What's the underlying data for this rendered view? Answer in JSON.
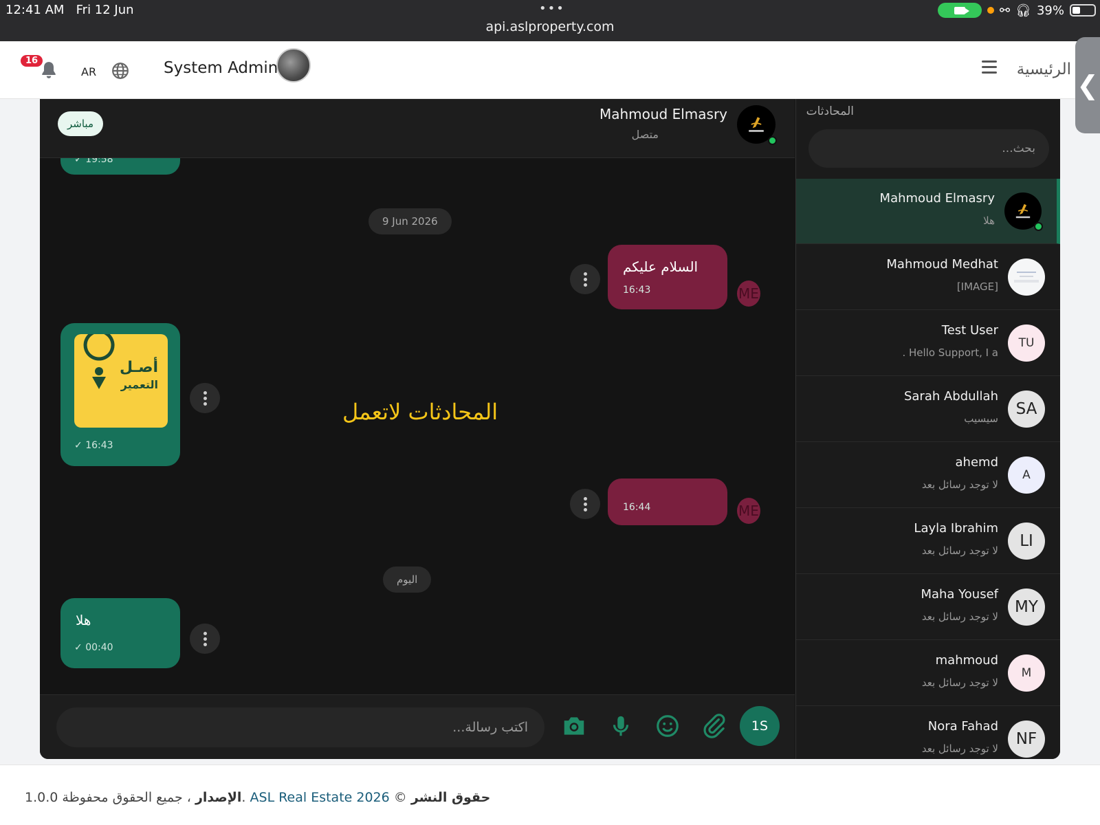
{
  "status_bar": {
    "time": "12:41 AM",
    "date": "Fri 12 Jun",
    "url": "api.aslproperty.com",
    "battery": "39%"
  },
  "header": {
    "notification_count": "16",
    "language": "AR",
    "user_name": "System Admin 1",
    "home_label": "الرئيسية"
  },
  "sidebar": {
    "title": "المحادثات",
    "search_placeholder": "بحث...",
    "conversations": [
      {
        "name": "Mahmoud Elmasry",
        "preview": "هلا",
        "avatar": "logo",
        "online": true,
        "active": true
      },
      {
        "name": "Mahmoud Medhat",
        "preview": "[IMAGE]",
        "avatar": "image"
      },
      {
        "name": "Test User",
        "preview": "Hello Support, I a .",
        "initials": "TU"
      },
      {
        "name": "Sarah Abdullah",
        "preview": "سيسيب",
        "initials": "SA"
      },
      {
        "name": "ahemd",
        "preview": "لا توجد رسائل بعد",
        "initials": "A"
      },
      {
        "name": "Layla Ibrahim",
        "preview": "لا توجد رسائل بعد",
        "initials": "LI"
      },
      {
        "name": "Maha Yousef",
        "preview": "لا توجد رسائل بعد",
        "initials": "MY"
      },
      {
        "name": "mahmoud",
        "preview": "لا توجد رسائل بعد",
        "initials": "M"
      },
      {
        "name": "Nora Fahad",
        "preview": "لا توجد رسائل بعد",
        "initials": "NF"
      }
    ]
  },
  "chat": {
    "live_label": "مباشر",
    "peer_name": "Mahmoud Elmasry",
    "peer_status": "متصل",
    "top_partial_time": "19:58",
    "date_pill_1": "9 Jun 2026",
    "msg_1_text": "السلام عليكم",
    "msg_1_time": "16:43",
    "msg_2_time": "16:43",
    "msg_2_logo_line1": "أصـل",
    "msg_2_logo_line2": "التعمير",
    "msg_3_time": "16:44",
    "date_pill_2": "اليوم",
    "msg_4_text": "هلا",
    "msg_4_time": "00:40",
    "me_initials": "ME",
    "overlay_text": "المحادثات لاتعمل",
    "composer_placeholder": "اكتب رسالة...",
    "sender_initials": "1S"
  },
  "footer": {
    "copyright_label": "حقوق النشر",
    "copyright_symbol": "©",
    "brand": "ASL Real Estate 2026",
    "rights": "، جميع الحقوق محفوظة.",
    "version_label": "الإصدار",
    "version": "1.0.0"
  },
  "colors": {
    "accent_green": "#17725a",
    "outgoing_red": "#7a1f3e",
    "badge_red": "#e0243a",
    "overlay_yellow": "#f5c518"
  }
}
